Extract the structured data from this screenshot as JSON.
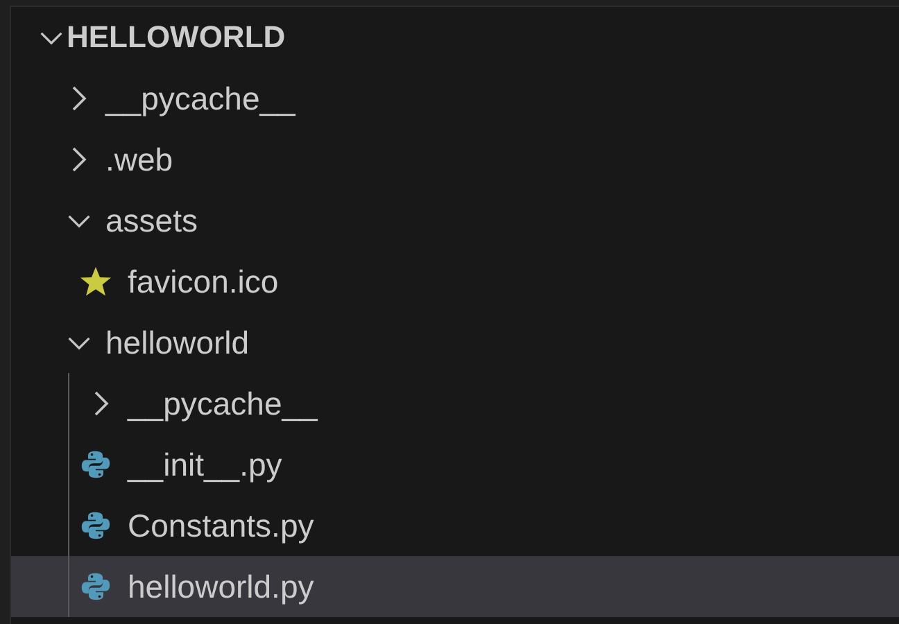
{
  "explorer": {
    "root": {
      "label": "HELLOWORLD",
      "kind": "folder",
      "expanded": true,
      "selected": false,
      "children": [
        {
          "label": "__pycache__",
          "kind": "folder",
          "expanded": false,
          "selected": false
        },
        {
          "label": ".web",
          "kind": "folder",
          "expanded": false,
          "selected": false
        },
        {
          "label": "assets",
          "kind": "folder",
          "expanded": true,
          "selected": false,
          "children": [
            {
              "label": "favicon.ico",
              "kind": "favicon",
              "selected": false
            }
          ]
        },
        {
          "label": "helloworld",
          "kind": "folder",
          "expanded": true,
          "selected": false,
          "children": [
            {
              "label": "__pycache__",
              "kind": "folder",
              "expanded": false,
              "selected": false
            },
            {
              "label": "__init__.py",
              "kind": "python",
              "selected": false
            },
            {
              "label": "Constants.py",
              "kind": "python",
              "selected": false
            },
            {
              "label": "helloworld.py",
              "kind": "python",
              "selected": true
            }
          ]
        }
      ]
    }
  }
}
